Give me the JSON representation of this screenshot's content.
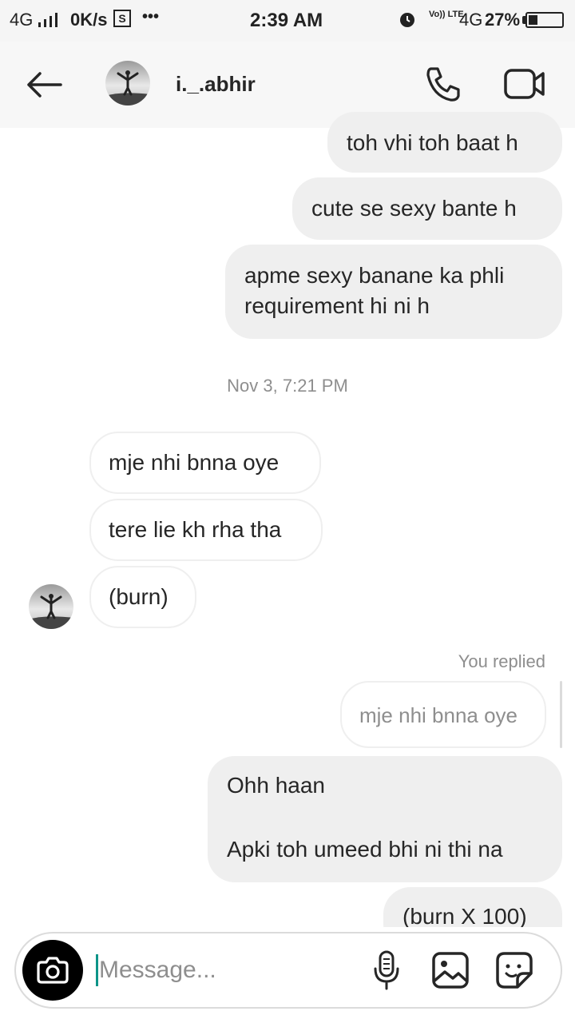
{
  "status_bar": {
    "network": "4G",
    "speed": "0K/s",
    "s_icon": "S",
    "dots": "•••",
    "time": "2:39 AM",
    "volte": "Vo)) LTE",
    "network2": "4G",
    "battery": "27%"
  },
  "header": {
    "username": "i._.abhir",
    "icons": [
      "back-arrow-icon",
      "phone-icon",
      "video-camera-icon"
    ]
  },
  "messages_before": [
    {
      "text": "toh vhi toh baat h"
    },
    {
      "text": "cute se sexy bante h"
    },
    {
      "text": "apme sexy banane ka phli requirement hi ni h"
    }
  ],
  "timestamp": "Nov 3, 7:21 PM",
  "messages_received": [
    {
      "text": "mje nhi bnna oye"
    },
    {
      "text": "tere lie kh rha tha"
    },
    {
      "text": "(burn)"
    }
  ],
  "reply": {
    "label": "You replied",
    "quoted": "mje nhi bnna oye"
  },
  "messages_after": [
    {
      "line1": "Ohh haan",
      "line2": "Apki toh umeed bhi ni thi na"
    },
    {
      "text": "(burn X 100)"
    }
  ],
  "composer": {
    "placeholder": "Message...",
    "icons": [
      "camera-icon",
      "microphone-icon",
      "gallery-icon",
      "sticker-icon"
    ]
  },
  "colors": {
    "sent_bubble": "#efefef",
    "received_border": "#efefef",
    "muted_text": "#8e8e8e",
    "cursor": "#0d9488"
  }
}
